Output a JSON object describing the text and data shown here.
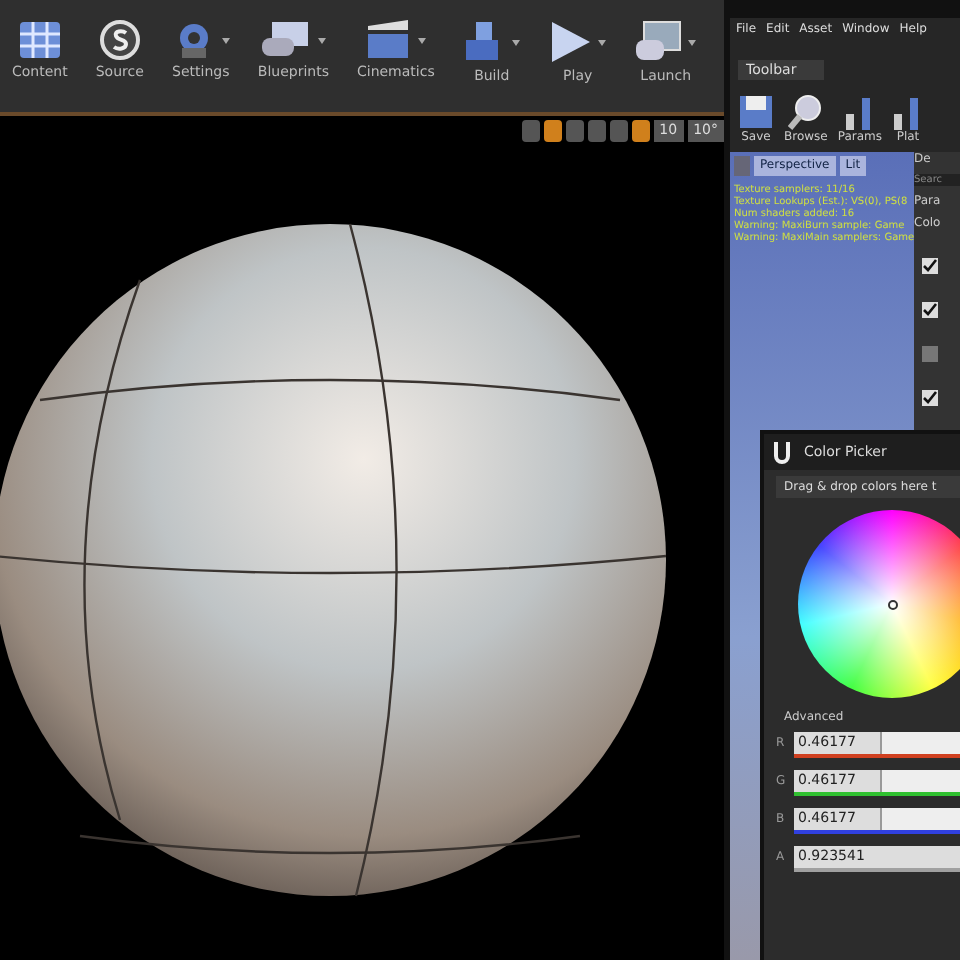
{
  "main_toolbar": {
    "buttons": [
      {
        "label": "Content"
      },
      {
        "label": "Source"
      },
      {
        "label": "Settings"
      },
      {
        "label": "Blueprints"
      },
      {
        "label": "Cinematics"
      },
      {
        "label": "Build"
      },
      {
        "label": "Play"
      },
      {
        "label": "Launch"
      }
    ]
  },
  "viewport_toolbar": {
    "toggles": [
      {
        "selected": false
      },
      {
        "selected": true
      },
      {
        "selected": false
      },
      {
        "selected": false
      },
      {
        "selected": false
      },
      {
        "selected": true
      }
    ],
    "grid_snap": "10",
    "rotation_snap": "10°"
  },
  "material_editor": {
    "menu": [
      "File",
      "Edit",
      "Asset",
      "Window",
      "Help"
    ],
    "tab": "Toolbar",
    "tools": [
      {
        "label": "Save"
      },
      {
        "label": "Browse"
      },
      {
        "label": "Params"
      },
      {
        "label": "Plat"
      }
    ],
    "preview": {
      "view": "Perspective",
      "mode": "Lit",
      "stats": [
        "Texture samplers: 11/16",
        "Texture Lookups (Est.): VS(0), PS(8",
        "Num shaders added: 16",
        "Warning: MaxiBurn sample: Game",
        "Warning: MaxiMain samplers: Game"
      ]
    },
    "details": {
      "tab": "De",
      "search_placeholder": "Searc",
      "sections": [
        "Para",
        "Colo"
      ],
      "checkboxes": [
        {
          "checked": true
        },
        {
          "checked": true
        },
        {
          "checked": false
        },
        {
          "checked": true
        }
      ]
    }
  },
  "color_picker": {
    "title": "Color Picker",
    "drop_hint": "Drag & drop colors here t",
    "advanced": "Advanced",
    "channels": [
      {
        "label": "R",
        "value": "0.46177",
        "color": "#d04020",
        "level": 0.46
      },
      {
        "label": "G",
        "value": "0.46177",
        "color": "#30c030",
        "level": 0.46
      },
      {
        "label": "B",
        "value": "0.46177",
        "color": "#3040e0",
        "level": 0.46
      },
      {
        "label": "A",
        "value": "0.923541",
        "color": "#a0a0a0",
        "level": 0.92
      }
    ]
  }
}
